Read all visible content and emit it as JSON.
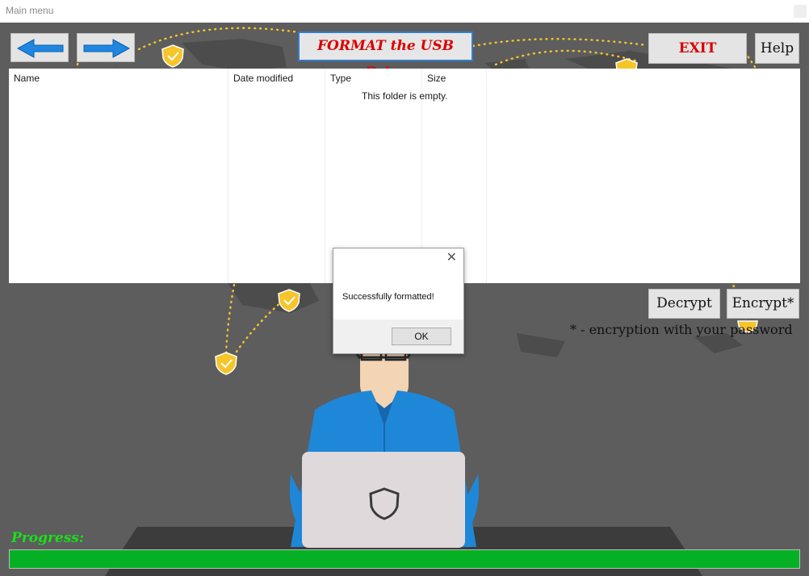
{
  "window": {
    "title": "Main menu"
  },
  "toolbar": {
    "back_icon": "arrow-left-icon",
    "forward_icon": "arrow-right-icon",
    "format_label": "FORMAT the USB Drive",
    "exit_label": "EXIT",
    "help_label": "Help"
  },
  "file_list": {
    "columns": [
      "Name",
      "Date modified",
      "Type",
      "Size"
    ],
    "sort_indicator": "^",
    "empty_message": "This folder is empty."
  },
  "actions": {
    "decrypt_label": "Decrypt",
    "encrypt_label": "Encrypt*",
    "encrypt_note": "* - encryption with your password"
  },
  "dialog": {
    "close_icon": "close-icon",
    "message": "Successfully formatted!",
    "ok_label": "OK"
  },
  "progress": {
    "label": "Progress:",
    "value_percent": 100,
    "color": "#06b025"
  },
  "colors": {
    "accent_red": "#d90000",
    "accent_blue": "#2f7fd1",
    "shield_yellow": "#f5c52a",
    "background": "#5d5d5d"
  }
}
